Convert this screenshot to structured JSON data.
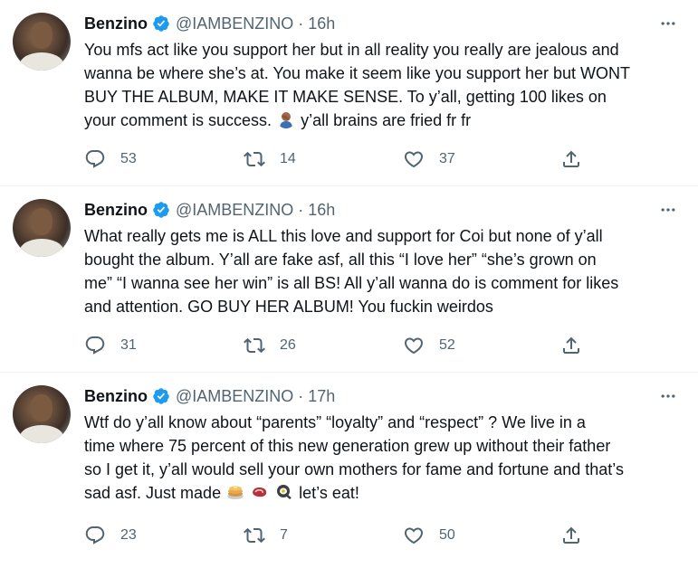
{
  "tweets": [
    {
      "name": "Benzino",
      "handle": "@IAMBENZINO",
      "separator": "·",
      "time": "16h",
      "lines": [
        "You mfs act like you support her but in all reality you really are jealous and",
        "wanna be where she’s at. You make it seem like you support her but WONT",
        "BUY THE ALBUM, MAKE IT MAKE SENSE. To y’all, getting 100 likes on",
        "your comment is success."
      ],
      "line4_suffix": "y’all brains are fried fr fr",
      "emojis": [
        "person-facepalming-emoji"
      ],
      "replies": "53",
      "retweets": "14",
      "likes": "37"
    },
    {
      "name": "Benzino",
      "handle": "@IAMBENZINO",
      "separator": "·",
      "time": "16h",
      "lines": [
        "What really gets me is ALL this love and support for Coi but none of y’all",
        "bought the album. Y’all are fake asf, all this “I love her” “she’s grown on",
        "me” “I wanna see her win” is all BS! All y’all wanna do is comment for likes",
        "and attention. GO BUY HER ALBUM! You fuckin weirdos"
      ],
      "replies": "31",
      "retweets": "26",
      "likes": "52"
    },
    {
      "name": "Benzino",
      "handle": "@IAMBENZINO",
      "separator": "·",
      "time": "17h",
      "lines": [
        "Wtf do y’all know about “parents” “loyalty” and “respect” ? We live in a",
        "time where 75 percent of this new generation grew up without their father",
        "so I get it, y’all would sell your own mothers for fame and fortune and that’s",
        "sad asf. Just made"
      ],
      "line4_suffix": "let’s eat!",
      "emojis": [
        "pancakes-emoji",
        "cut-of-meat-emoji",
        "cooking-emoji"
      ],
      "replies": "23",
      "retweets": "7",
      "likes": "50"
    }
  ],
  "colors": {
    "text": "#0f1419",
    "secondary": "#536471",
    "verified": "#1d9bf0",
    "divider": "#eff3f4"
  }
}
